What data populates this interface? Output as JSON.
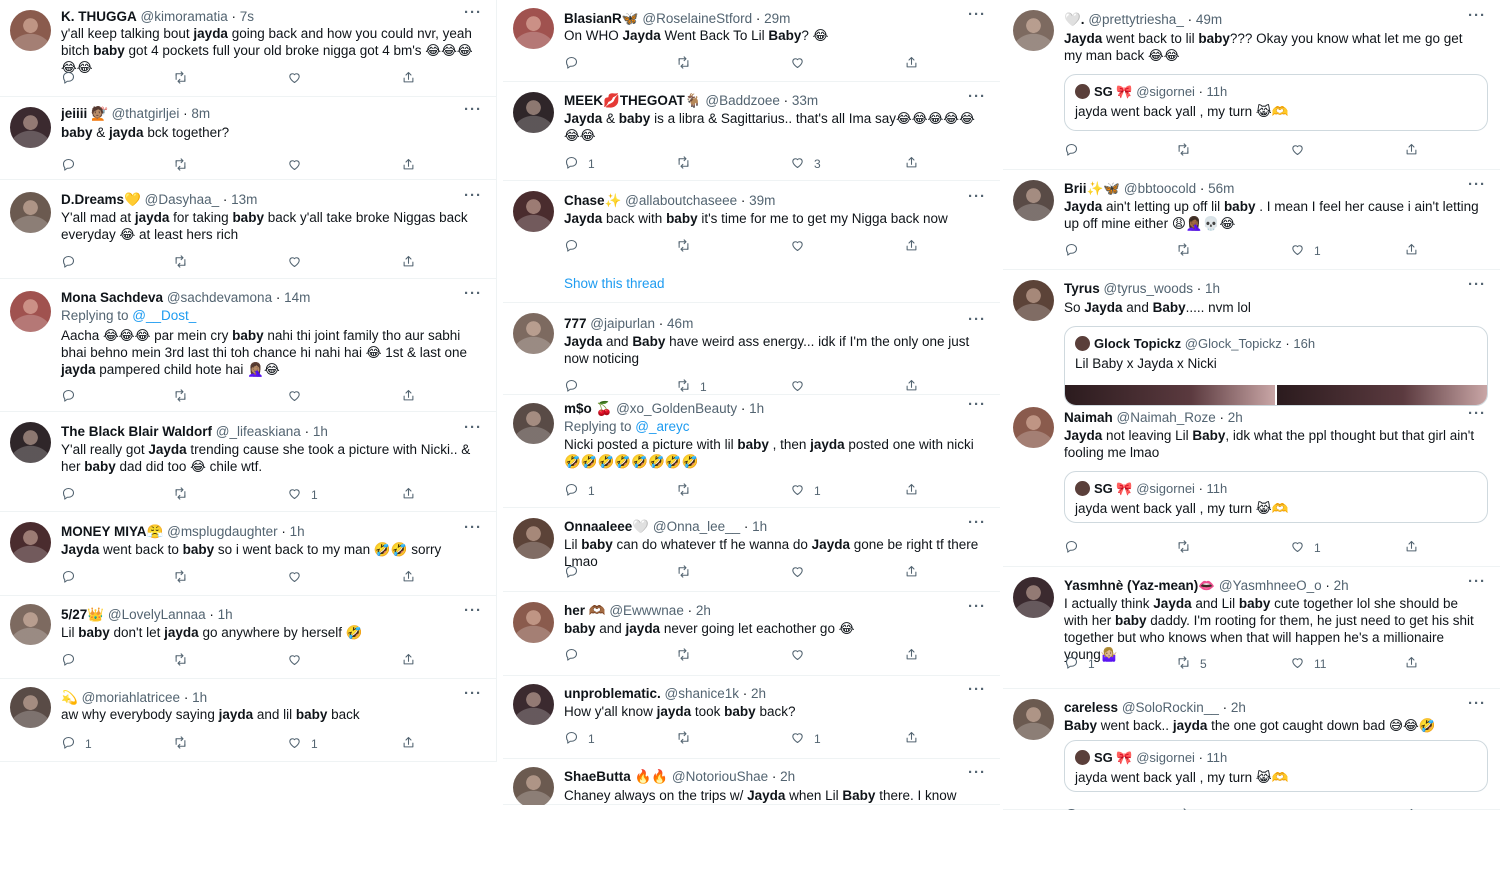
{
  "action_labels": [
    "reply",
    "retweet",
    "like",
    "share"
  ],
  "more_glyph": "···",
  "columns": [
    {
      "tweets": [
        {
          "name": "K. THUGGA",
          "handle": "@kimoramatia",
          "time": "7s",
          "text": "y'all keep talking bout <b>jayda</b> going back and how you could nvr, yeah bitch <b>baby</b> got 4 pockets full your old broke nigga got 4 bm's 😂😂😂😂😂",
          "counts": [
            "",
            "",
            "",
            ""
          ]
        },
        {
          "name": "jeiiii 💇🏽",
          "handle": "@thatgirljei",
          "time": "8m",
          "text": "<b>baby</b> &amp; <b>jayda</b> bck together?",
          "counts": [
            "",
            "",
            "",
            ""
          ]
        },
        {
          "name": "D.Dreams💛",
          "handle": "@Dasyhaa_",
          "time": "13m",
          "text": "Y'all mad at <b>jayda</b> for taking <b>baby</b> back y'all take broke Niggas back everyday 😂 at least hers rich",
          "counts": [
            "",
            "",
            "",
            ""
          ]
        },
        {
          "name": "Mona Sachdeva",
          "handle": "@sachdevamona",
          "time": "14m",
          "replying_label": "Replying to",
          "replying_to": "@__Dost_",
          "text": "Aacha 😂😂😂 par mein cry <b>baby</b> nahi thi joint family tho aur sabhi bhai behno mein 3rd last thi toh chance hi nahi hai 😂 1st &amp; last one <b>jayda</b> pampered child hote hai 🤦🏽‍♀️😂",
          "counts": [
            "",
            "",
            "",
            ""
          ]
        },
        {
          "name": "The Black Blair Waldorf",
          "handle": "@_lifeaskiana",
          "time": "1h",
          "text": "Y'all really got <b>Jayda</b> trending cause she took a picture with Nicki.. &amp; her <b>baby</b> dad did too 😂 chile wtf.",
          "counts": [
            "",
            "",
            "1",
            ""
          ]
        },
        {
          "name": "MONEY MIYA😤",
          "handle": "@msplugdaughter",
          "time": "1h",
          "text": "<b>Jayda</b> went back to <b>baby</b> so i went back to my man 🤣🤣 sorry",
          "counts": [
            "",
            "",
            "",
            ""
          ]
        },
        {
          "name": "5/27👑",
          "handle": "@LovelyLannaa",
          "time": "1h",
          "text": "Lil <b>baby</b> don't let <b>jayda</b> go anywhere  by herself 🤣",
          "counts": [
            "",
            "",
            "",
            ""
          ]
        },
        {
          "name": "💫",
          "handle": "@moriahlatricee",
          "time": "1h",
          "text": "aw why everybody saying <b>jayda</b> and lil <b>baby</b> back",
          "counts": [
            "1",
            "",
            "1",
            ""
          ]
        }
      ]
    },
    {
      "tweets": [
        {
          "name": "BlasianR🦋",
          "handle": "@RoselaineStford",
          "time": "29m",
          "text": "On WHO <b>Jayda</b> Went Back To Lil <b>Baby</b>? 😂",
          "counts": [
            "",
            "",
            "",
            ""
          ]
        },
        {
          "name": "MEEK💋THEGOAT🐐",
          "handle": "@Baddzoee",
          "time": "33m",
          "text": "<b>Jayda</b> &amp; <b>baby</b> is a libra &amp; Sagittarius.. that's all Ima say😂😂😂😂😂😂😂",
          "counts": [
            "1",
            "",
            "3",
            ""
          ]
        },
        {
          "name": "Chase✨",
          "handle": "@allaboutchaseee",
          "time": "39m",
          "text": "<b>Jayda</b> back with <b>baby</b> it's time for me to get my Nigga back now",
          "counts": [
            "",
            "",
            "",
            ""
          ],
          "show_thread": "Show this thread"
        },
        {
          "name": "777",
          "handle": "@jaipurlan",
          "time": "46m",
          "text": "<b>Jayda</b> and <b>Baby</b> have weird ass energy... idk if I'm the only one just now noticing",
          "counts": [
            "",
            "1",
            "",
            ""
          ]
        },
        {
          "name": "m$o 🍒",
          "handle": "@xo_GoldenBeauty",
          "time": "1h",
          "replying_label": "Replying to",
          "replying_to": "@_areyc",
          "text": "Nicki posted a picture with lil <b>baby</b> , then <b>jayda</b> posted one with nicki 🤣🤣🤣🤣🤣🤣🤣🤣",
          "counts": [
            "1",
            "",
            "1",
            ""
          ]
        },
        {
          "name": "Onnaaleee🤍",
          "handle": "@Onna_lee__",
          "time": "1h",
          "text": "Lil <b>baby</b> can do whatever tf he wanna do <b>Jayda</b> gone be right tf there Lmao",
          "counts": [
            "",
            "",
            "",
            ""
          ]
        },
        {
          "name": "her 🫶🏾",
          "handle": "@Ewwwnae",
          "time": "2h",
          "text": "<b>baby</b> and <b>jayda</b> never going let eachother go 😂",
          "counts": [
            "",
            "",
            "",
            ""
          ]
        },
        {
          "name": "unproblematic.",
          "handle": "@shanice1k",
          "time": "2h",
          "text": "How y'all know <b>jayda</b> took <b>baby</b> back?",
          "counts": [
            "1",
            "",
            "1",
            ""
          ]
        },
        {
          "name": "ShaeButta 🔥🔥",
          "handle": "@NotoriouShae",
          "time": "2h",
          "text": "Chaney always on the trips w/ <b>Jayda</b> when Lil <b>Baby</b> there. I know that's",
          "counts": [
            "",
            "",
            "",
            ""
          ]
        }
      ]
    },
    {
      "tweets": [
        {
          "name": "🤍.",
          "handle": "@prettytriesha_",
          "time": "49m",
          "text": "<b>Jayda</b> went back to lil <b>baby</b>??? Okay you know what let me go get my man back 😂😂",
          "counts": [
            "",
            "",
            "",
            ""
          ],
          "quote": {
            "name": "SG 🎀",
            "handle": "@sigornei",
            "time": "11h",
            "text": "jayda went back yall , my turn 😹🫶"
          }
        },
        {
          "name": "Brii✨🦋",
          "handle": "@bbtoocold",
          "time": "56m",
          "text": "<b>Jayda</b> ain't letting up off lil <b>baby</b> . I mean I feel her cause i ain't letting up off mine either 😩🤦🏾‍♀️💀😂",
          "counts": [
            "",
            "",
            "1",
            ""
          ]
        },
        {
          "name": "Tyrus",
          "handle": "@tyrus_woods",
          "time": "1h",
          "text": "So <b>Jayda</b> and <b>Baby</b>..... nvm lol",
          "counts": [
            "",
            "",
            "",
            ""
          ],
          "quote": {
            "name": "Glock Topickz",
            "handle": "@Glock_Topickz",
            "time": "16h",
            "text": "Lil Baby x Jayda x Nicki"
          }
        },
        {
          "name": "Naimah",
          "handle": "@Naimah_Roze",
          "time": "2h",
          "text": "<b>Jayda</b> not leaving Lil <b>Baby</b>, idk what the ppl thought but that girl ain't fooling me lmao",
          "counts": [
            "",
            "",
            "1",
            ""
          ],
          "quote": {
            "name": "SG 🎀",
            "handle": "@sigornei",
            "time": "11h",
            "text": "jayda went back yall , my turn 😹🫶"
          }
        },
        {
          "name": "Yasmhnè (Yaz-mean)👄",
          "handle": "@YasmhneeO_o",
          "time": "2h",
          "text": "I actually think <b>Jayda</b> and Lil <b>baby</b> cute together lol she should be with her <b>baby</b> daddy. I'm rooting for them, he just need to get his shit together but who knows when that will happen he's a millionaire young🤷🏼‍♀️",
          "counts": [
            "1",
            "5",
            "11",
            ""
          ]
        },
        {
          "name": "careless",
          "handle": "@SoloRockin__",
          "time": "2h",
          "text": "<b>Baby</b> went back.. <b>jayda</b> the one got caught down bad 😅😂🤣",
          "counts": [
            "",
            "",
            "",
            ""
          ],
          "quote": {
            "name": "SG 🎀",
            "handle": "@sigornei",
            "time": "11h",
            "text": "jayda went back yall , my turn 😹🫶"
          }
        }
      ]
    }
  ]
}
